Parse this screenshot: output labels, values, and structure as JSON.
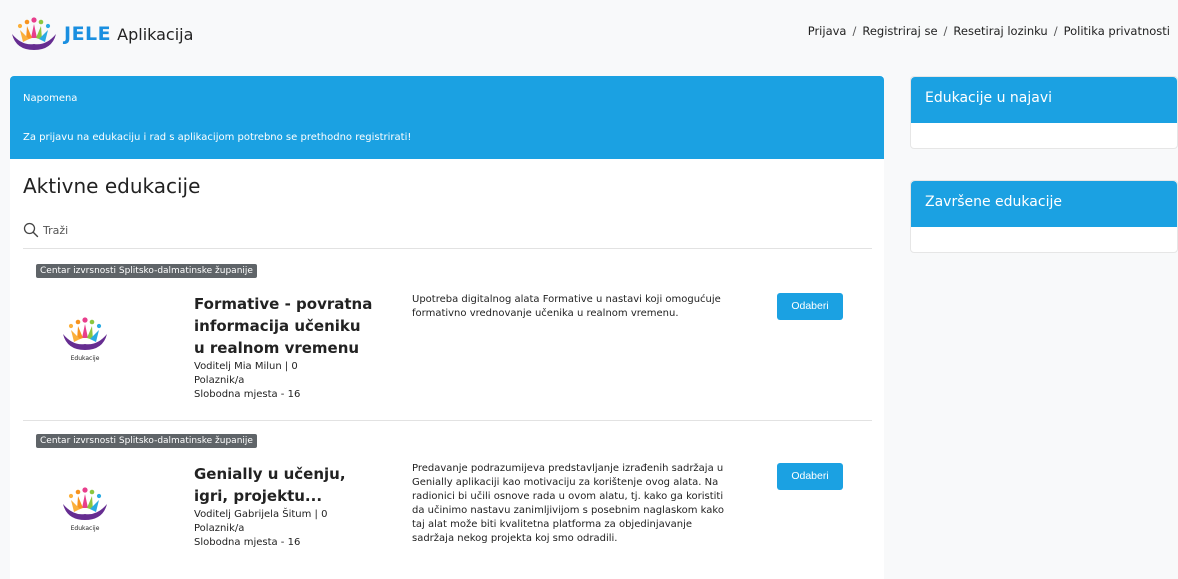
{
  "header": {
    "brand_bold": "JELE",
    "brand_app": "Aplikacija",
    "nav": [
      "Prijava",
      "Registriraj se",
      "Resetiraj lozinku",
      "Politika privatnosti"
    ],
    "separator": "/"
  },
  "notice": {
    "title": "Napomena",
    "message": "Za prijavu na edukaciju i rad s aplikacijom potrebno se prethodno registrirati!"
  },
  "main": {
    "heading": "Aktivne edukacije",
    "search_placeholder": "Traži"
  },
  "courses": [
    {
      "tag": "Centar izvrsnosti Splitsko-dalmatinske županije",
      "thumb_caption": "Edukacije",
      "title": "Formative - povratna informacija učeniku u realnom vremenu",
      "leader": "Voditelj Mia Milun | 0",
      "role": "Polaznik/a",
      "seats": "Slobodna mjesta - 16",
      "description": "Upotreba digitalnog alata Formative u nastavi koji omogućuje formativno vrednovanje učenika u realnom vremenu.",
      "button": "Odaberi"
    },
    {
      "tag": "Centar izvrsnosti Splitsko-dalmatinske županije",
      "thumb_caption": "Edukacije",
      "title": "Genially u učenju, igri, projektu...",
      "leader": "Voditelj Gabrijela Šitum | 0",
      "role": "Polaznik/a",
      "seats": "Slobodna mjesta - 16",
      "description": "Predavanje podrazumijeva predstavljanje izrađenih sadržaja u Genially aplikaciji kao motivaciju za korištenje ovog alata. Na radionici bi učili osnove rada u ovom alatu, tj. kako ga koristiti da učinimo nastavu zanimljivijom s posebnim naglaskom kako taj alat može biti kvalitetna platforma za objedinjavanje sadržaja nekog projekta koj smo odradili.",
      "button": "Odaberi"
    }
  ],
  "sidebar": {
    "upcoming_title": "Edukacije u najavi",
    "finished_title": "Završene edukacije"
  },
  "colors": {
    "accent": "#1ba1e2",
    "brand": "#1a8fe0",
    "tag": "#5f6468"
  },
  "icons": {
    "search": "search-icon",
    "logo": "lotus-logo-icon"
  }
}
